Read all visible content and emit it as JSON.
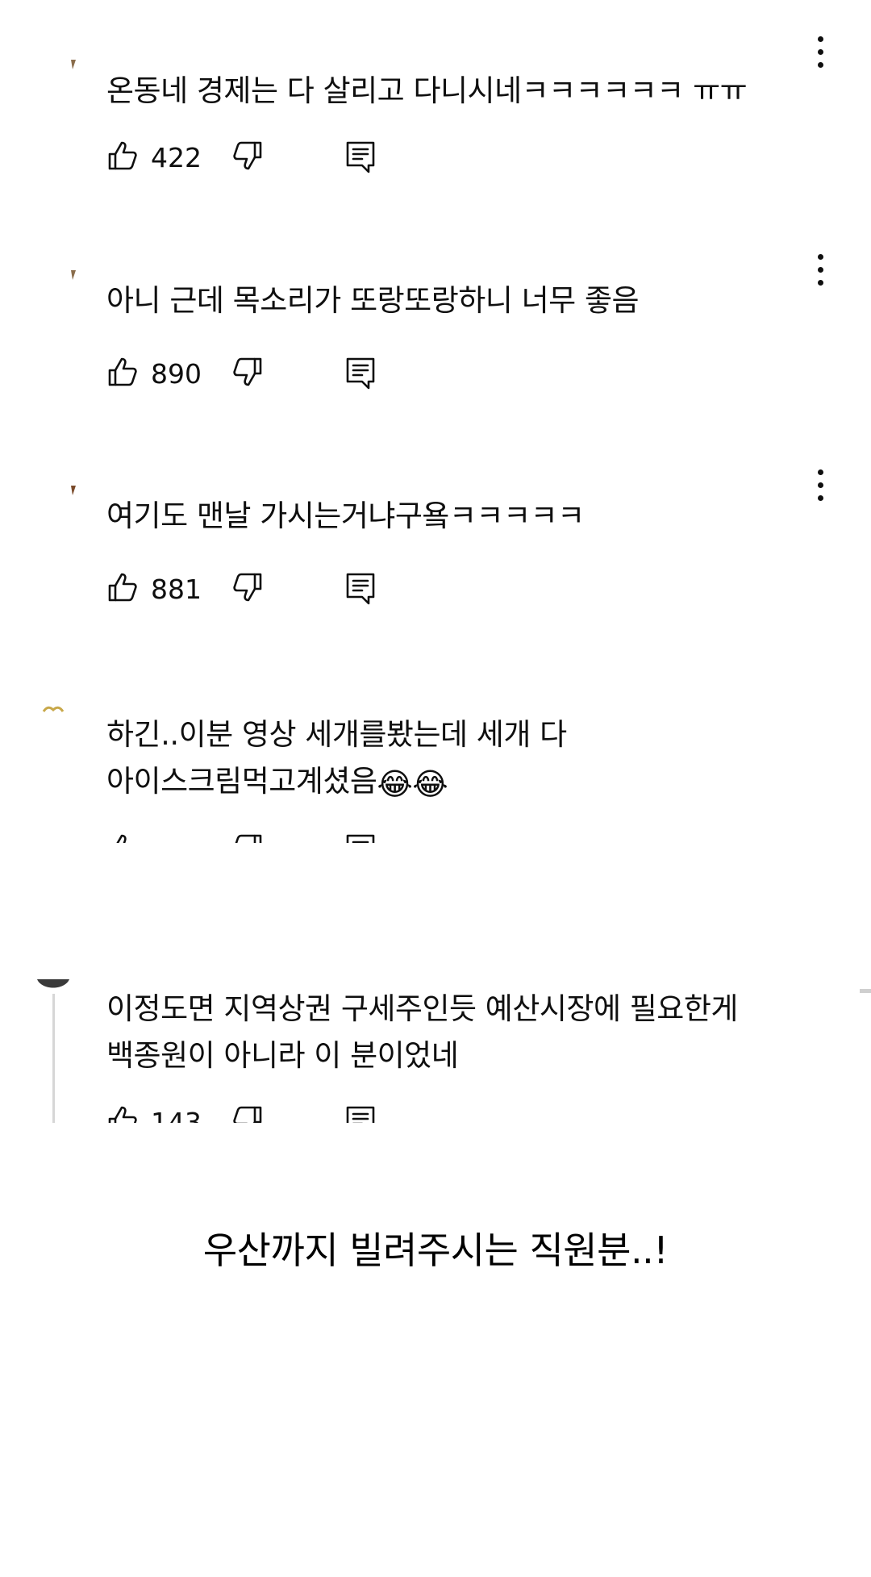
{
  "comments": [
    {
      "text": "온동네 경제는 다 살리고 다니시네ㅋㅋㅋㅋㅋㅋ ㅠㅠ",
      "likes": "422",
      "avatar_color": "#8a6d4b"
    },
    {
      "text": "아니 근데 목소리가 또랑또랑하니 너무 좋음",
      "likes": "890",
      "avatar_color": "#8a6d4b"
    },
    {
      "text": "여기도 맨날 가시는거냐구욬ㅋㅋㅋㅋㅋ",
      "likes": "881",
      "avatar_color": "#7a4a2a"
    },
    {
      "text": "하긴..이분 영상 세개를봤는데 세개 다 아이스크림먹고계셨음",
      "emoji": "😂😂",
      "likes": "",
      "avatar_color": "#e0c878"
    },
    {
      "text": "이정도면 지역상권 구세주인듯 예산시장에 필요한게 백종원이 아니라 이 분이었네",
      "likes": "143",
      "avatar_color": "#3a3a3a"
    }
  ],
  "caption": "우산까지 빌려주시는 직원분..!",
  "icons": {
    "like": "thumbs-up-icon",
    "dislike": "thumbs-down-icon",
    "reply": "reply-comment-icon",
    "more": "more-vert-icon"
  },
  "colors": {
    "text": "#0f0f0f",
    "background": "#ffffff",
    "reply_line": "#d6d6d6"
  }
}
